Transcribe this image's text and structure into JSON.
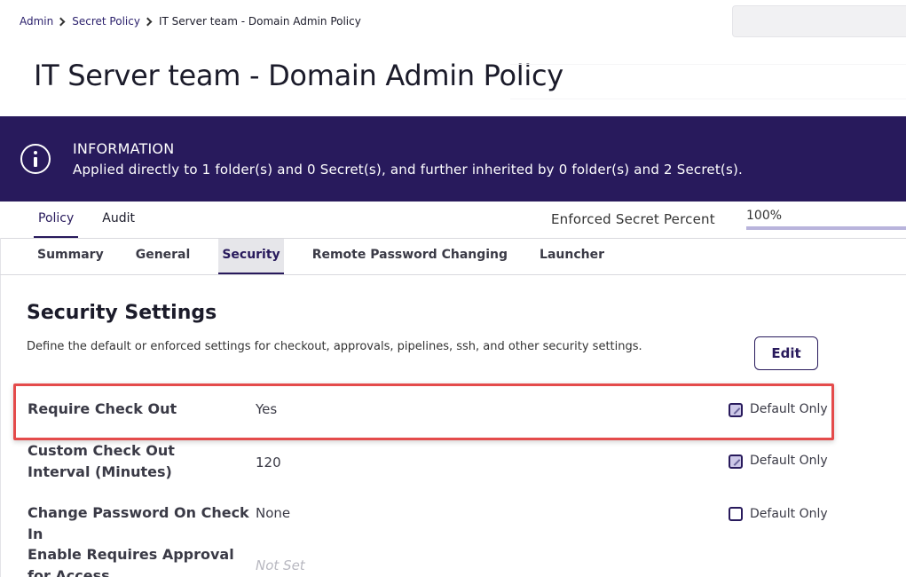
{
  "breadcrumb": {
    "items": [
      {
        "label": "Admin"
      },
      {
        "label": "Secret Policy"
      },
      {
        "label": "IT Server team - Domain Admin Policy"
      }
    ]
  },
  "page": {
    "title": "IT Server team - Domain Admin Policy"
  },
  "banner": {
    "title": "INFORMATION",
    "text": "Applied directly to 1 folder(s) and 0 Secret(s), and further inherited by 0 folder(s) and 2 Secret(s).",
    "icon": "info-icon",
    "background": "#281a5c"
  },
  "top_tabs": [
    {
      "label": "Policy",
      "active": true
    },
    {
      "label": "Audit",
      "active": false
    }
  ],
  "enforced": {
    "label": "Enforced Secret Percent",
    "value": "100%",
    "progress": 1.0
  },
  "sub_tabs": [
    {
      "label": "Summary",
      "active": false
    },
    {
      "label": "General",
      "active": false
    },
    {
      "label": "Security",
      "active": true
    },
    {
      "label": "Remote Password Changing",
      "active": false
    },
    {
      "label": "Launcher",
      "active": false
    }
  ],
  "section": {
    "title": "Security Settings",
    "description": "Define the default or enforced settings for checkout, approvals, pipelines, ssh, and other security settings.",
    "edit_label": "Edit"
  },
  "settings": [
    {
      "label": "Require Check Out",
      "value": "Yes",
      "default_only": true,
      "check_label": "Default Only"
    },
    {
      "label": "Custom Check Out Interval (Minutes)",
      "value": "120",
      "default_only": true,
      "check_label": "Default Only"
    },
    {
      "label": "Change Password On Check In",
      "value": "None",
      "default_only": false,
      "check_label": "Default Only"
    },
    {
      "label": "Enable Requires Approval for Access",
      "value": "Not Set"
    }
  ],
  "colors": {
    "accent": "#281a5c",
    "highlight": "#e44b4b"
  }
}
